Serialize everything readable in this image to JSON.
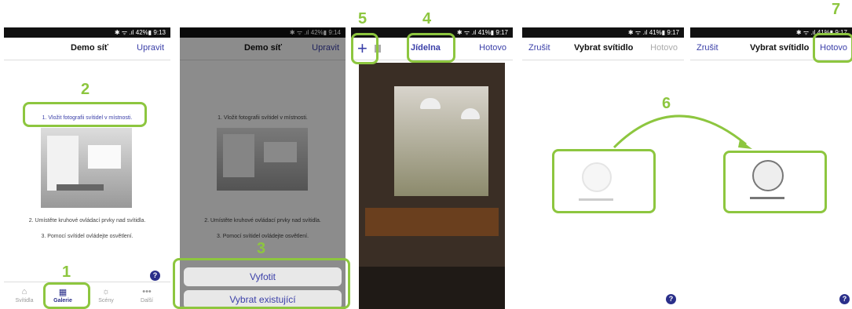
{
  "screens": {
    "s1": {
      "status": "✱ ᯤ .ıl 42%▮ 9:13",
      "title": "Demo síť",
      "edit": "Upravit",
      "step1": "1. Vložit fotografii svítidel v místnosti.",
      "step2": "2. Umístěte kruhové ovládací prvky nad svítidla.",
      "step3": "3. Pomocí svítidel ovládejte osvětlení.",
      "tabs": [
        {
          "label": "Svítidla",
          "icon": "lamp-icon"
        },
        {
          "label": "Galerie",
          "icon": "grid-icon"
        },
        {
          "label": "Scény",
          "icon": "sun-icon"
        },
        {
          "label": "Další",
          "icon": "more-icon"
        }
      ],
      "help": "?"
    },
    "s2": {
      "status": "✱ ᯤ .ıl 42%▮ 9:14",
      "title": "Demo síť",
      "edit": "Upravit",
      "step1": "1. Vložit fotografii svítidel v místnosti.",
      "step2": "2. Umístěte kruhové ovládací prvky nad svítidla.",
      "step3": "3. Pomocí svítidel ovládejte osvětlení.",
      "btn_photo": "Vyfotit",
      "btn_existing": "Vybrat existující"
    },
    "s3": {
      "status": "✱ ᯤ .ıl 41%▮ 9:17",
      "plus": "+",
      "title": "Jídelna",
      "done": "Hotovo"
    },
    "s4": {
      "status": "✱ ᯤ .ıl 41%▮ 9:17",
      "cancel": "Zrušit",
      "title": "Vybrat svítidlo",
      "done": "Hotovo",
      "help": "?"
    },
    "s5": {
      "status": "✱ ᯤ .ıl 41%▮ 9:17",
      "cancel": "Zrušit",
      "title": "Vybrat svítidlo",
      "done": "Hotovo",
      "help": "?"
    }
  },
  "steps": [
    "1",
    "2",
    "3",
    "4",
    "5",
    "6",
    "7"
  ],
  "colors": {
    "accent": "#8dc63f",
    "link": "#3a3fa8",
    "help": "#2a2f8a"
  }
}
